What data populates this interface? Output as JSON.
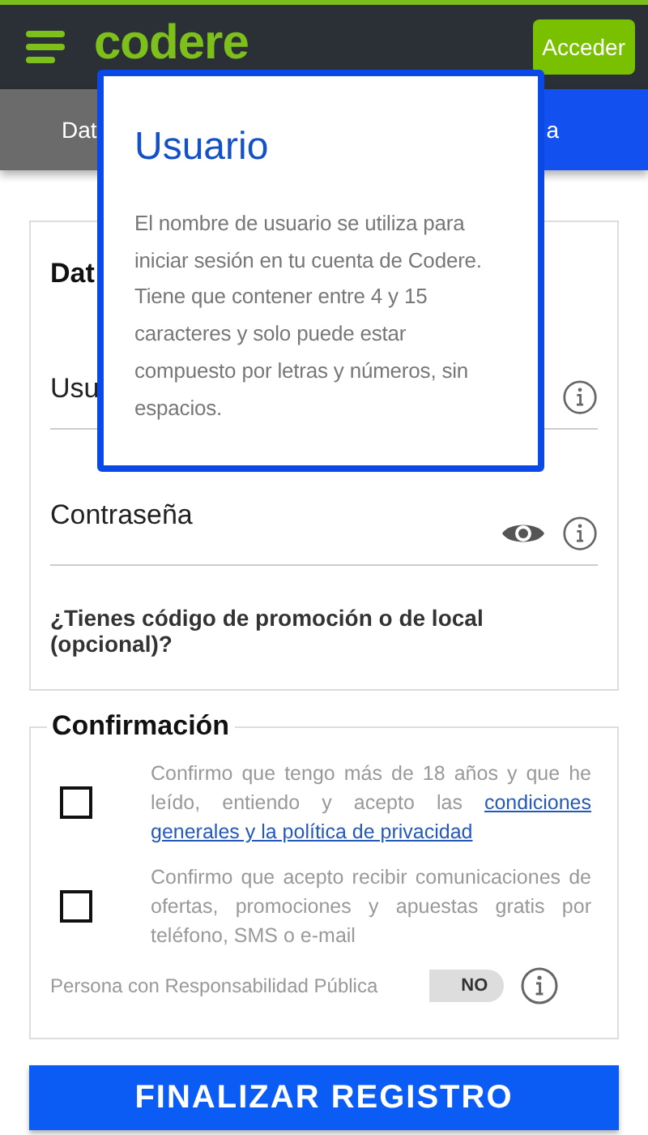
{
  "header": {
    "logo": "codere",
    "login_button": "Acceder"
  },
  "tabs": [
    {
      "label": "Dat",
      "selected": false
    },
    {
      "label": "a",
      "selected": true
    }
  ],
  "account_card": {
    "heading": "Dat",
    "fields": [
      {
        "label": "Usu",
        "kind": "text"
      },
      {
        "label": "Contraseña",
        "kind": "password"
      }
    ],
    "promo_question": "¿Tienes código de promoción o de local (opcional)?"
  },
  "confirmation": {
    "legend": "Confirmación",
    "items": [
      {
        "text": "Confirmo que tengo más de 18 años y que he leído, entiendo y acepto las ",
        "link_lines": [
          "condiciones",
          "generales y la política de privacidad"
        ],
        "checked": false
      },
      {
        "text": "Confirmo que acepto recibir comunicaciones de ofertas, promociones y apuestas gratis por teléfono, SMS o e-mail",
        "checked": false
      }
    ],
    "pep": {
      "label": "Persona con Responsabilidad Pública",
      "toggle_text": "NO",
      "on": false
    }
  },
  "submit_button": "FINALIZAR REGISTRO",
  "tooltip": {
    "title": "Usuario",
    "body": "El nombre de usuario se utiliza para iniciar sesión en tu cuenta de Codere. Tiene que contener entre 4 y 15 caracteres y solo puede estar compuesto por letras y números, sin espacios."
  }
}
